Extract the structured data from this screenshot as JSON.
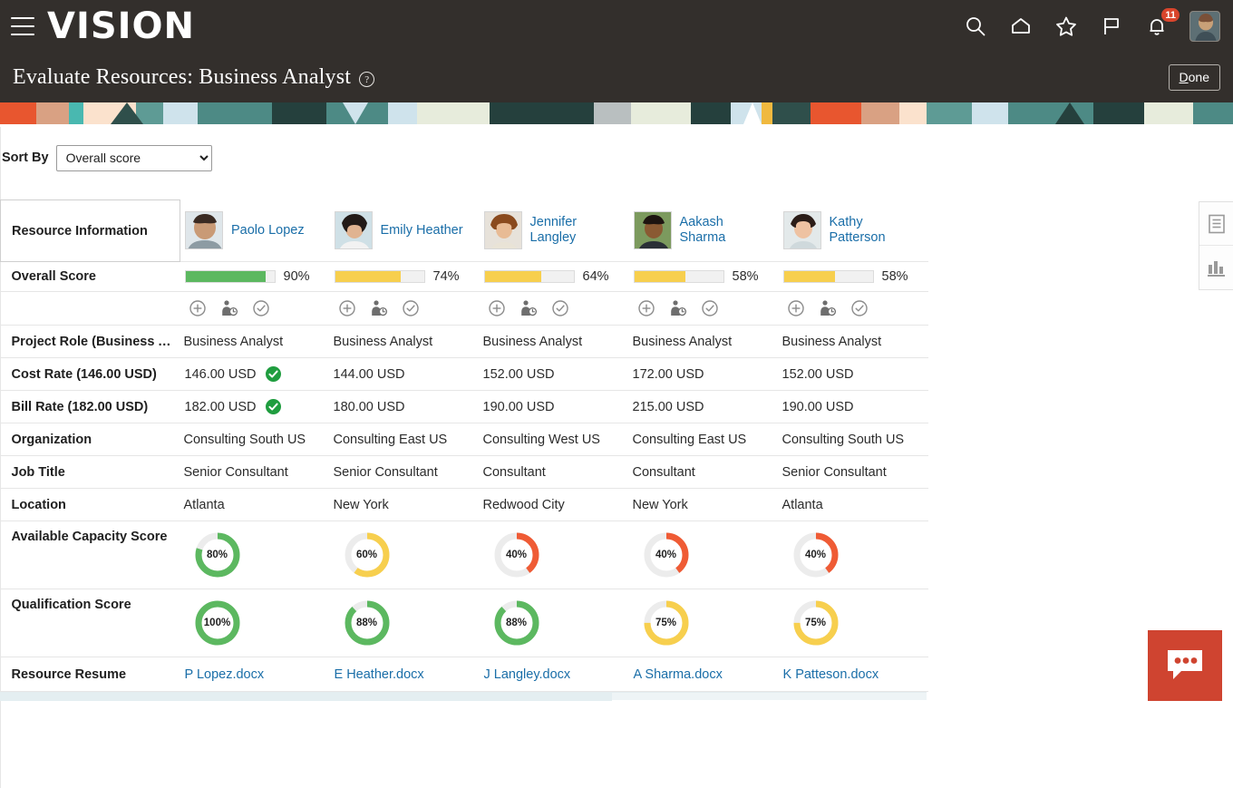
{
  "header": {
    "logo": "VISION",
    "menu_icon": "hamburger-icon",
    "page_title": "Evaluate Resources: Business Analyst",
    "help_icon": "?",
    "done_label_key": "D",
    "done_label_rest": "one",
    "icons": [
      {
        "name": "search-icon"
      },
      {
        "name": "home-icon"
      },
      {
        "name": "favorites-star-icon"
      },
      {
        "name": "flag-icon"
      },
      {
        "name": "notifications-bell-icon",
        "badge": "11"
      }
    ],
    "avatar": "user-avatar"
  },
  "toolbar": {
    "sort_label": "Sort By",
    "sort_value": "Overall score",
    "sort_options": [
      "Overall score"
    ]
  },
  "table": {
    "header_label": "Resource Information",
    "resources": [
      {
        "name": "Paolo Lopez",
        "name_line1": "Paolo Lopez",
        "name_line2": ""
      },
      {
        "name": "Emily Heather",
        "name_line1": "Emily Heather",
        "name_line2": ""
      },
      {
        "name": "Jennifer Langley",
        "name_line1": "Jennifer",
        "name_line2": "Langley"
      },
      {
        "name": "Aakash Sharma",
        "name_line1": "Aakash",
        "name_line2": "Sharma"
      },
      {
        "name": "Kathy Patterson",
        "name_line1": "Kathy",
        "name_line2": "Patterson"
      }
    ],
    "rows": {
      "overall_score": {
        "label": "Overall Score",
        "values": [
          "90%",
          "74%",
          "64%",
          "58%",
          "58%"
        ],
        "percents": [
          90,
          74,
          64,
          58,
          58
        ],
        "colors": [
          "#5cb860",
          "#f7cf4e",
          "#f7cf4e",
          "#f7cf4e",
          "#f7cf4e"
        ]
      },
      "actions": {
        "icons": [
          "add-icon",
          "resource-availability-icon",
          "confirm-icon"
        ]
      },
      "project_role": {
        "label": "Project Role (Business A…",
        "values": [
          "Business Analyst",
          "Business Analyst",
          "Business Analyst",
          "Business Analyst",
          "Business Analyst"
        ]
      },
      "cost_rate": {
        "label": "Cost Rate (146.00 USD)",
        "values": [
          "146.00 USD",
          "144.00 USD",
          "152.00 USD",
          "172.00 USD",
          "152.00 USD"
        ],
        "match": [
          true,
          false,
          false,
          false,
          false
        ]
      },
      "bill_rate": {
        "label": "Bill Rate (182.00 USD)",
        "values": [
          "182.00 USD",
          "180.00 USD",
          "190.00 USD",
          "215.00 USD",
          "190.00 USD"
        ],
        "match": [
          true,
          false,
          false,
          false,
          false
        ]
      },
      "organization": {
        "label": "Organization",
        "values": [
          "Consulting South US",
          "Consulting East US",
          "Consulting West US",
          "Consulting East US",
          "Consulting South US"
        ]
      },
      "job_title": {
        "label": "Job Title",
        "values": [
          "Senior Consultant",
          "Senior Consultant",
          "Consultant",
          "Consultant",
          "Senior Consultant"
        ]
      },
      "location": {
        "label": "Location",
        "values": [
          "Atlanta",
          "New York",
          "Redwood City",
          "New York",
          "Atlanta"
        ]
      },
      "available_capacity": {
        "label": "Available Capacity Score",
        "values": [
          "80%",
          "60%",
          "40%",
          "40%",
          "40%"
        ],
        "percents": [
          80,
          60,
          40,
          40,
          40
        ],
        "colors": [
          "#5cb860",
          "#f7cf4e",
          "#ef5b35",
          "#ef5b35",
          "#ef5b35"
        ]
      },
      "qualification": {
        "label": "Qualification Score",
        "values": [
          "100%",
          "88%",
          "88%",
          "75%",
          "75%"
        ],
        "percents": [
          100,
          88,
          88,
          75,
          75
        ],
        "colors": [
          "#5cb860",
          "#5cb860",
          "#5cb860",
          "#f7cf4e",
          "#f7cf4e"
        ]
      },
      "resume": {
        "label": "Resource Resume",
        "values": [
          "P Lopez.docx",
          "E Heather.docx",
          "J Langley.docx",
          "A Sharma.docx",
          "K Patteson.docx"
        ]
      }
    }
  },
  "right_rail": {
    "buttons": [
      {
        "name": "list-view-icon"
      },
      {
        "name": "chart-view-icon"
      }
    ]
  },
  "chat": {
    "name": "chat-bubble-icon"
  },
  "colors": {
    "header_bg": "#332f2c",
    "link": "#1a6ea8",
    "green": "#5cb860",
    "amber": "#f7cf4e",
    "red": "#ef5b35",
    "chat_red": "#cf4430",
    "badge_red": "#d9452c"
  }
}
